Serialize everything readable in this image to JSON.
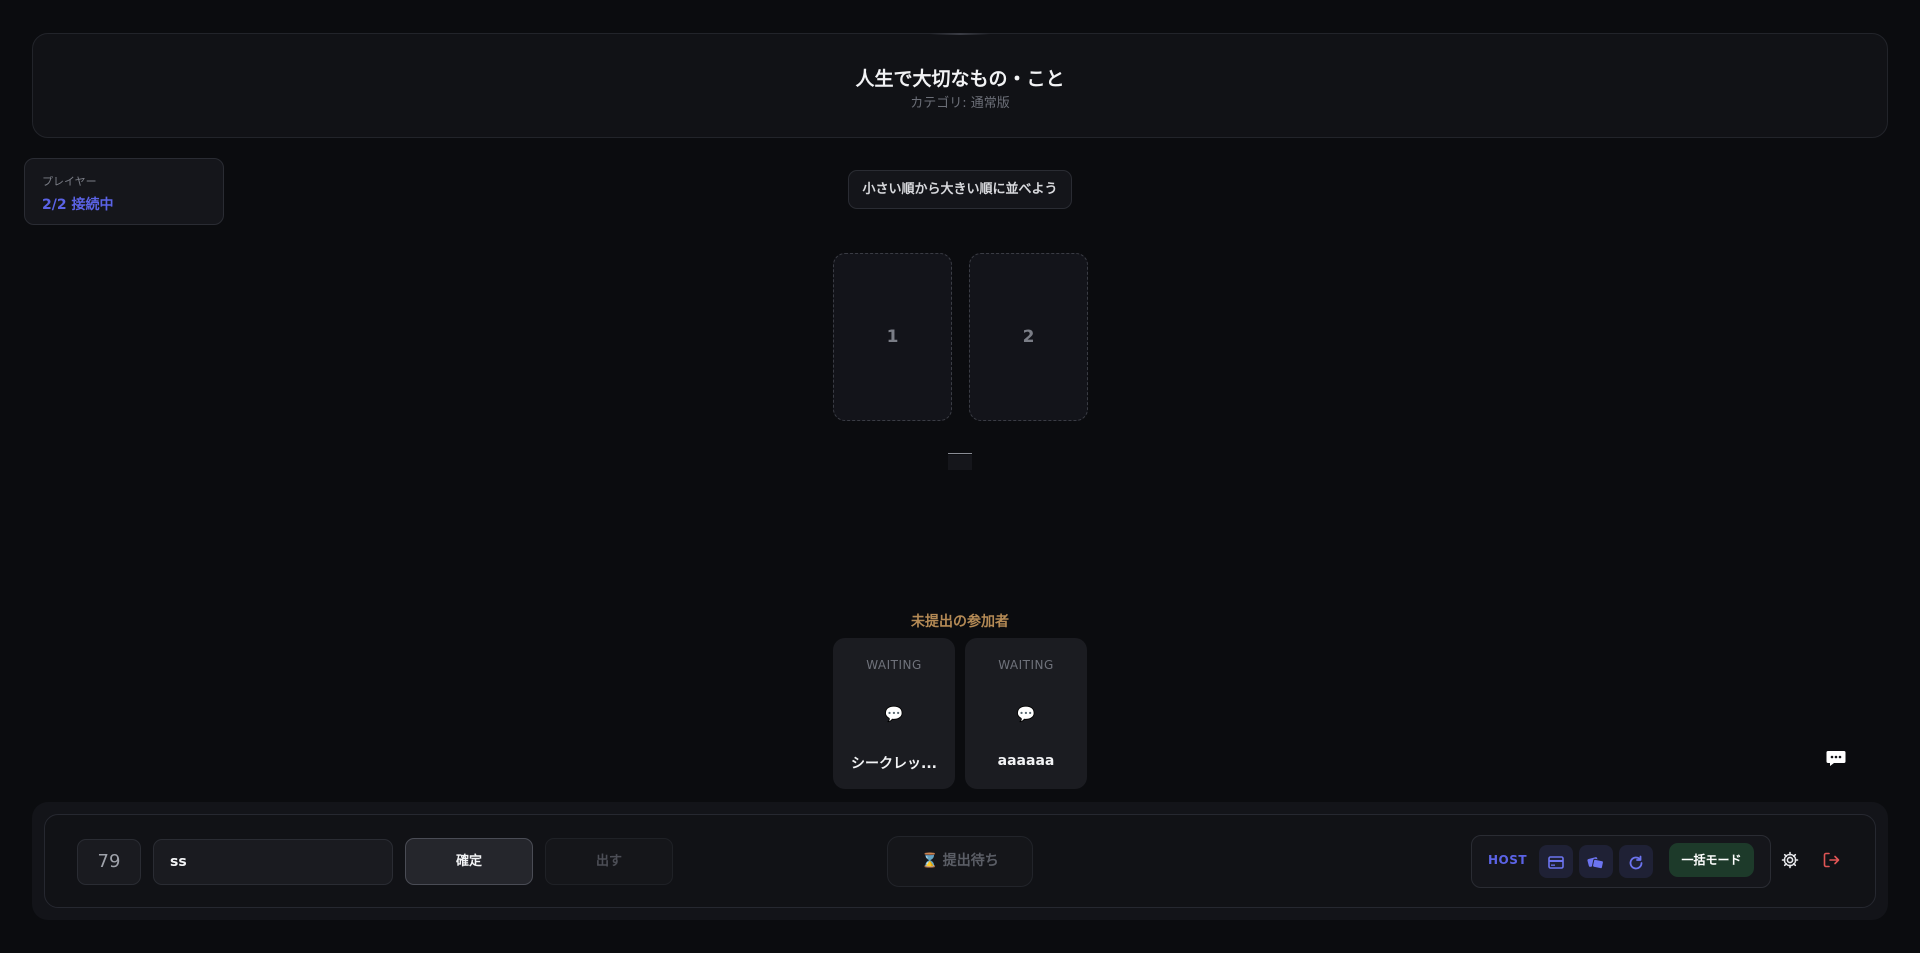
{
  "topic": {
    "title": "人生で大切なもの・こと",
    "category": "カテゴリ: 通常版"
  },
  "players": {
    "label": "プレイヤー",
    "status": "2/2 接続中"
  },
  "instruction": "小さい順から大きい順に並べよう",
  "slots": [
    "1",
    "2"
  ],
  "pending": {
    "heading": "未提出の参加者",
    "participants": [
      {
        "state": "WAITING",
        "icon": "💬",
        "name": "シークレッ..."
      },
      {
        "state": "WAITING",
        "icon": "💬",
        "name": "aaaaaa"
      }
    ]
  },
  "controls": {
    "number": "79",
    "input_value": "ss",
    "confirm_label": "確定",
    "submit_label": "出す",
    "wait_icon": "⌛",
    "wait_label": "提出待ち"
  },
  "host": {
    "label": "HOST",
    "icons": [
      "card-icon",
      "cards-icon",
      "refresh-icon"
    ],
    "batch_mode_label": "一括モード"
  },
  "colors": {
    "accent": "#5b63e6",
    "warning": "#b48a55",
    "exit": "#e05555",
    "batch_bg": "#1d3a2a"
  }
}
